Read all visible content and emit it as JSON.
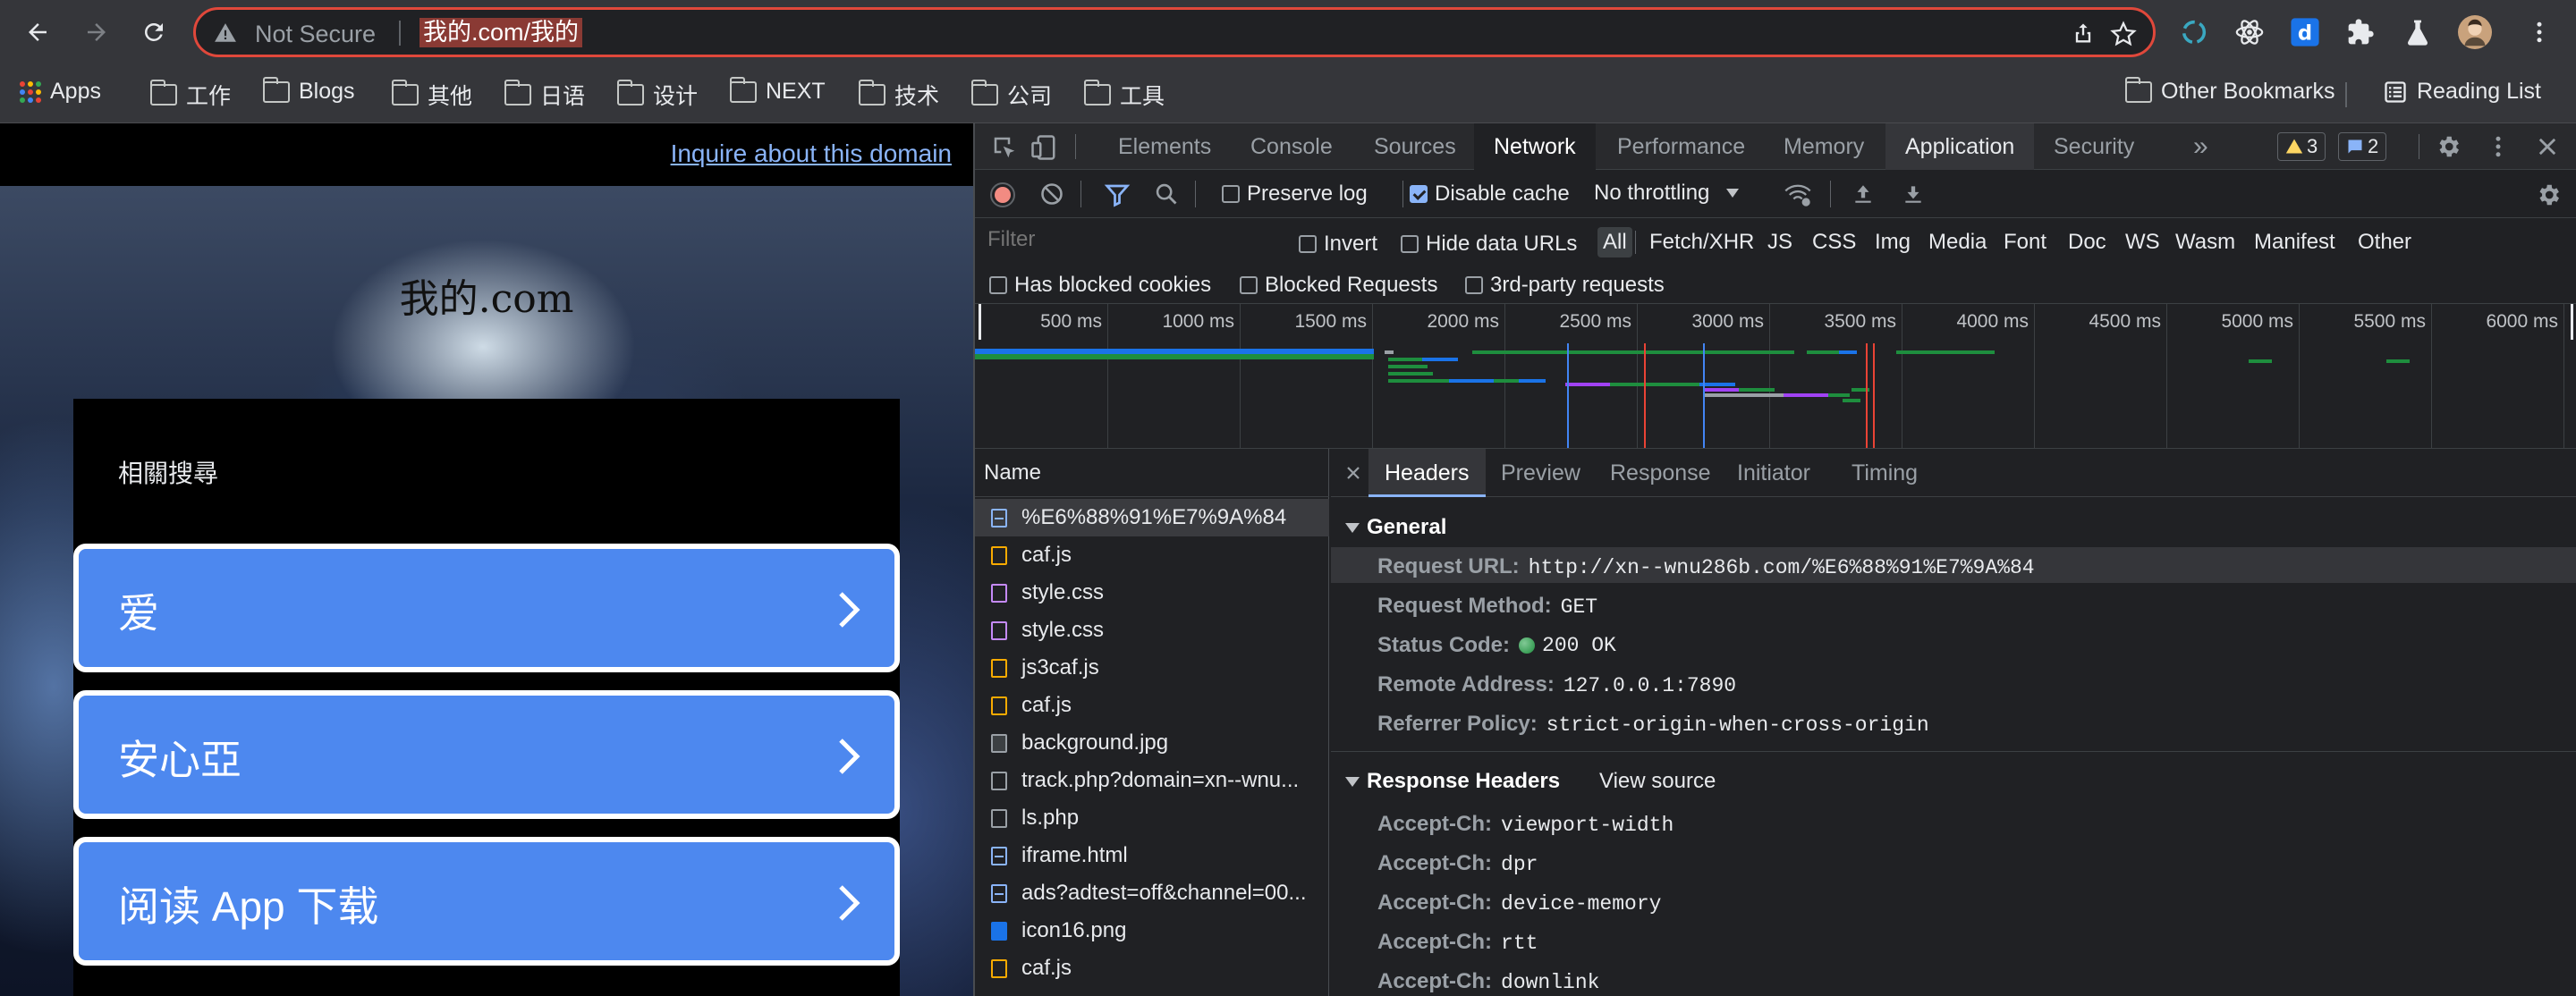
{
  "browser": {
    "security_label": "Not Secure",
    "url": "我的.com/我的",
    "bookmarks": [
      {
        "label": "Apps"
      },
      {
        "label": "工作"
      },
      {
        "label": "Blogs"
      },
      {
        "label": "其他"
      },
      {
        "label": "日语"
      },
      {
        "label": "设计"
      },
      {
        "label": "NEXT"
      },
      {
        "label": "技术"
      },
      {
        "label": "公司"
      },
      {
        "label": "工具"
      }
    ],
    "other_bookmarks": "Other Bookmarks",
    "reading_list": "Reading List"
  },
  "page": {
    "inquire_link": "Inquire about this domain",
    "site_name": "我的.com",
    "related_heading": "相關搜尋",
    "links": [
      {
        "label": "爱"
      },
      {
        "label": "安心亞"
      },
      {
        "label": "阅读 App 下载"
      }
    ]
  },
  "devtools": {
    "tabs": [
      "Elements",
      "Console",
      "Sources",
      "Network",
      "Performance",
      "Memory",
      "Application",
      "Security"
    ],
    "active_tab": "Network",
    "more_tabs": "»",
    "warnings_count": "3",
    "messages_count": "2",
    "toolbar": {
      "preserve_log": "Preserve log",
      "disable_cache": "Disable cache",
      "throttling": "No throttling"
    },
    "filter": {
      "placeholder": "Filter",
      "invert": "Invert",
      "hide_data_urls": "Hide data URLs",
      "types": [
        "All",
        "Fetch/XHR",
        "JS",
        "CSS",
        "Img",
        "Media",
        "Font",
        "Doc",
        "WS",
        "Wasm",
        "Manifest",
        "Other"
      ],
      "has_blocked_cookies": "Has blocked cookies",
      "blocked_requests": "Blocked Requests",
      "third_party": "3rd-party requests"
    },
    "timeline_ticks": [
      "500 ms",
      "1000 ms",
      "1500 ms",
      "2000 ms",
      "2500 ms",
      "3000 ms",
      "3500 ms",
      "4000 ms",
      "4500 ms",
      "5000 ms",
      "5500 ms",
      "6000 ms"
    ],
    "name_header": "Name",
    "requests": [
      {
        "name": "%E6%88%91%E7%9A%84",
        "type": "doc"
      },
      {
        "name": "caf.js",
        "type": "js"
      },
      {
        "name": "style.css",
        "type": "css"
      },
      {
        "name": "style.css",
        "type": "css"
      },
      {
        "name": "js3caf.js",
        "type": "js"
      },
      {
        "name": "caf.js",
        "type": "js"
      },
      {
        "name": "background.jpg",
        "type": "img"
      },
      {
        "name": "track.php?domain=xn--wnu...",
        "type": "other"
      },
      {
        "name": "ls.php",
        "type": "other"
      },
      {
        "name": "iframe.html",
        "type": "doc"
      },
      {
        "name": "ads?adtest=off&channel=00...",
        "type": "doc"
      },
      {
        "name": "icon16.png",
        "type": "png"
      },
      {
        "name": "caf.js",
        "type": "js"
      }
    ],
    "detail_tabs": [
      "Headers",
      "Preview",
      "Response",
      "Initiator",
      "Timing"
    ],
    "general_title": "General",
    "general": [
      {
        "key": "Request URL:",
        "value": "http://xn--wnu286b.com/%E6%88%91%E7%9A%84"
      },
      {
        "key": "Request Method:",
        "value": "GET"
      },
      {
        "key": "Status Code:",
        "value": "200 OK"
      },
      {
        "key": "Remote Address:",
        "value": "127.0.0.1:7890"
      },
      {
        "key": "Referrer Policy:",
        "value": "strict-origin-when-cross-origin"
      }
    ],
    "response_headers_title": "Response Headers",
    "view_source": "View source",
    "response_headers": [
      {
        "key": "Accept-Ch:",
        "value": "viewport-width"
      },
      {
        "key": "Accept-Ch:",
        "value": "dpr"
      },
      {
        "key": "Accept-Ch:",
        "value": "device-memory"
      },
      {
        "key": "Accept-Ch:",
        "value": "rtt"
      },
      {
        "key": "Accept-Ch:",
        "value": "downlink"
      }
    ]
  },
  "colors": {
    "accent": "#8ab4f8",
    "link_button": "#4d88ef",
    "record": "#f28b82",
    "status_ok": "#34a853",
    "warning": "#fdd663"
  }
}
